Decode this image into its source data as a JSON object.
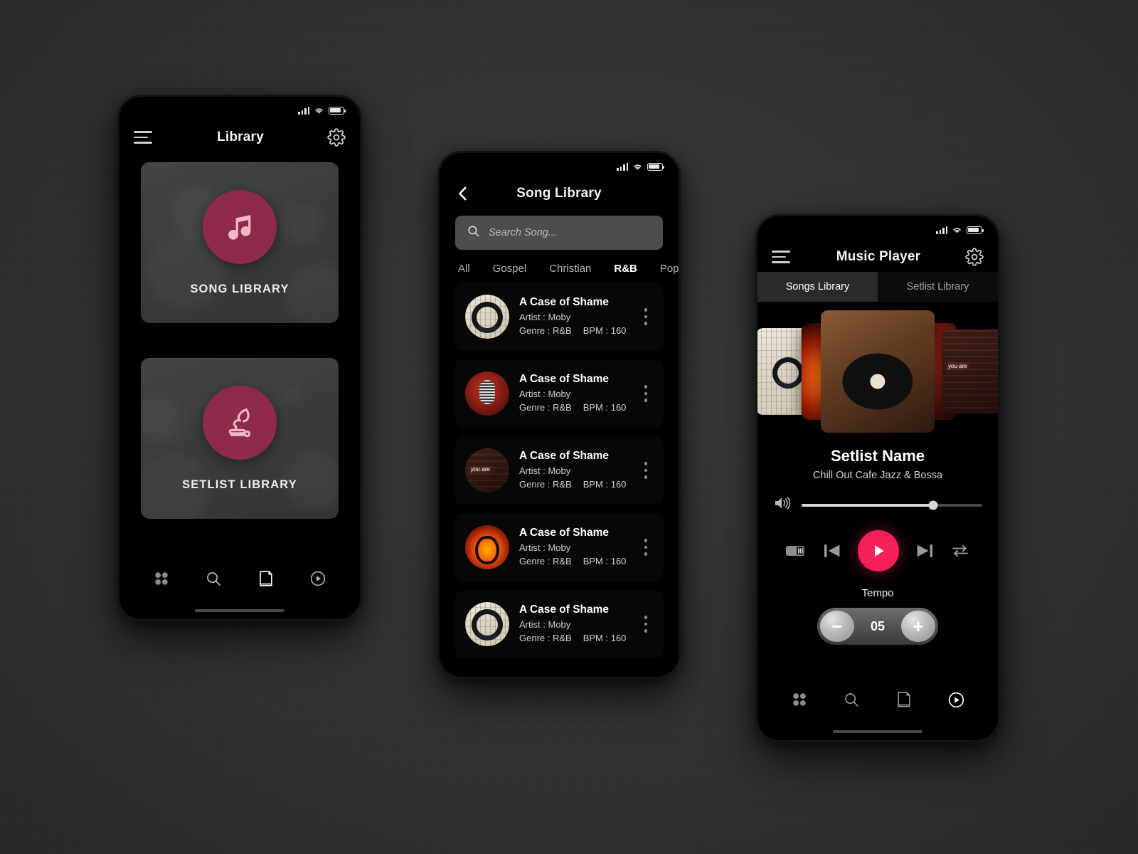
{
  "theme": {
    "background": "#333333",
    "screen_bg": "#000000",
    "accent_pink": "#F5205A",
    "accent_maroon": "#8E2B4A",
    "card_gray": "#3E3E3E"
  },
  "status_bar": {
    "signal_icon": "cellular-signal-icon",
    "wifi_icon": "wifi-icon",
    "battery_icon": "battery-icon"
  },
  "phone_library": {
    "menu_icon": "hamburger-menu-icon",
    "title": "Library",
    "settings_icon": "gear-icon",
    "cards": [
      {
        "label": "SONG LIBRARY",
        "icon": "music-note-icon"
      },
      {
        "label": "SETLIST LIBRARY",
        "icon": "gramophone-icon"
      }
    ],
    "bottom_nav": [
      {
        "name": "grid",
        "icon": "grid-icon",
        "active": false
      },
      {
        "name": "search",
        "icon": "search-icon",
        "active": false
      },
      {
        "name": "book",
        "icon": "book-icon",
        "active": true
      },
      {
        "name": "player",
        "icon": "play-circle-icon",
        "active": false
      }
    ]
  },
  "phone_songs": {
    "back_icon": "back-chevron-icon",
    "title": "Song Library",
    "search": {
      "icon": "search-icon",
      "placeholder": "Search Song...",
      "value": ""
    },
    "genres": [
      {
        "label": "All",
        "active": false
      },
      {
        "label": "Gospel",
        "active": false
      },
      {
        "label": "Christian",
        "active": false
      },
      {
        "label": "R&B",
        "active": true
      },
      {
        "label": "Pop",
        "active": false
      }
    ],
    "labels": {
      "artist_prefix": "Artist : ",
      "genre_prefix": "Genre : ",
      "bpm_prefix": "BPM : "
    },
    "songs": [
      {
        "title": "A Case of Shame",
        "artist": "Moby",
        "genre": "R&B",
        "bpm": "160",
        "art": "art-headphones",
        "art_name": "headphones-artwork",
        "menu_icon": "kebab-menu-icon"
      },
      {
        "title": "A Case of Shame",
        "artist": "Moby",
        "genre": "R&B",
        "bpm": "160",
        "art": "art-mic",
        "art_name": "microphone-artwork",
        "menu_icon": "kebab-menu-icon"
      },
      {
        "title": "A Case of Shame",
        "artist": "Moby",
        "genre": "R&B",
        "bpm": "160",
        "art": "art-neon",
        "art_name": "neon-sign-artwork",
        "menu_icon": "kebab-menu-icon"
      },
      {
        "title": "A Case of Shame",
        "artist": "Moby",
        "genre": "R&B",
        "bpm": "160",
        "art": "art-fireguitar",
        "art_name": "flaming-guitar-artwork",
        "menu_icon": "kebab-menu-icon"
      },
      {
        "title": "A Case of Shame",
        "artist": "Moby",
        "genre": "R&B",
        "bpm": "160",
        "art": "art-headphones",
        "art_name": "headphones-artwork",
        "menu_icon": "kebab-menu-icon"
      }
    ]
  },
  "phone_player": {
    "menu_icon": "hamburger-menu-icon",
    "title": "Music Player",
    "settings_icon": "gear-icon",
    "tabs": [
      {
        "label": "Songs Library",
        "active": true
      },
      {
        "label": "Setlist Library",
        "active": false
      }
    ],
    "carousel": [
      {
        "art": "art-headphones",
        "art_name": "headphones-artwork"
      },
      {
        "art": "art-fireguitar",
        "art_name": "flaming-guitar-artwork"
      },
      {
        "art": "art-turntable",
        "art_name": "turntable-artwork"
      },
      {
        "art": "art-mic",
        "art_name": "microphone-artwork"
      },
      {
        "art": "art-neon",
        "art_name": "neon-sign-artwork"
      }
    ],
    "setlist_name": "Setlist Name",
    "setlist_subtitle": "Chill Out Cafe Jazz & Bossa",
    "volume": {
      "icon": "volume-icon",
      "percent": 73
    },
    "controls": [
      {
        "name": "metronome-icon"
      },
      {
        "name": "previous-track-icon"
      },
      {
        "name": "play-icon"
      },
      {
        "name": "next-track-icon"
      },
      {
        "name": "repeat-icon"
      }
    ],
    "tempo": {
      "label": "Tempo",
      "value": "05",
      "minus": "−",
      "plus": "+"
    },
    "bottom_nav": [
      {
        "name": "grid",
        "icon": "grid-icon",
        "active": false
      },
      {
        "name": "search",
        "icon": "search-icon",
        "active": false
      },
      {
        "name": "book",
        "icon": "book-icon",
        "active": false
      },
      {
        "name": "player",
        "icon": "play-circle-icon",
        "active": true
      }
    ]
  }
}
